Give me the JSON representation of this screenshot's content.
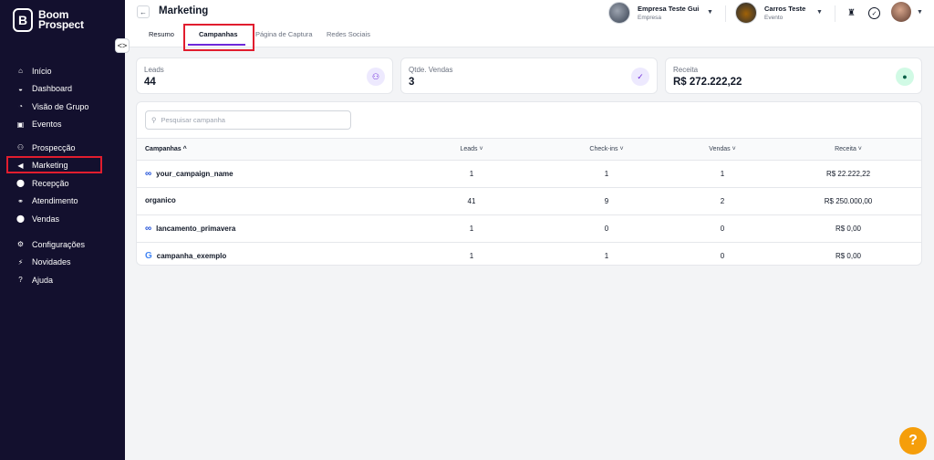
{
  "brand": {
    "line1": "Boom",
    "line2": "Prospect",
    "mark": "B"
  },
  "sidebar": {
    "groups": [
      [
        {
          "label": "Início",
          "icon": "home-icon",
          "glyph": "⌂"
        },
        {
          "label": "Dashboard",
          "icon": "dashboard-icon",
          "glyph": "◒"
        },
        {
          "label": "Visão de Grupo",
          "icon": "pie-chart-icon",
          "glyph": "◔"
        },
        {
          "label": "Eventos",
          "icon": "calendar-icon",
          "glyph": "▣"
        }
      ],
      [
        {
          "label": "Prospecção",
          "icon": "users-icon",
          "glyph": "⚇"
        },
        {
          "label": "Marketing",
          "icon": "megaphone-icon",
          "glyph": "◀",
          "active": true
        },
        {
          "label": "Recepção",
          "icon": "location-icon",
          "glyph": "⬤"
        },
        {
          "label": "Atendimento",
          "icon": "handshake-icon",
          "glyph": "⚭"
        },
        {
          "label": "Vendas",
          "icon": "money-icon",
          "glyph": "⬤"
        }
      ],
      [
        {
          "label": "Configurações",
          "icon": "gear-icon",
          "glyph": "⚙"
        },
        {
          "label": "Novidades",
          "icon": "bolt-icon",
          "glyph": "⚡"
        },
        {
          "label": "Ajuda",
          "icon": "question-icon",
          "glyph": "?"
        }
      ]
    ]
  },
  "header": {
    "title": "Marketing",
    "tabs": [
      "Resumo",
      "Campanhas",
      "Página de Captura",
      "Redes Sociais"
    ],
    "active_tab": 1,
    "account1": {
      "name": "Empresa Teste Gui",
      "sub": "Empresa"
    },
    "account2": {
      "name": "Carros Teste",
      "sub": "Evento"
    }
  },
  "stats": [
    {
      "label": "Leads",
      "value": "44",
      "icon": "users-icon",
      "glyph": "⚇",
      "bg": "#ede9fe",
      "fg": "#6d28d9"
    },
    {
      "label": "Qtde. Vendas",
      "value": "3",
      "icon": "check-circle-icon",
      "glyph": "✓",
      "bg": "#ede9fe",
      "fg": "#6d28d9"
    },
    {
      "label": "Receita",
      "value": "R$ 272.222,22",
      "icon": "user-icon",
      "glyph": "●",
      "bg": "#d1fae5",
      "fg": "#065f46"
    }
  ],
  "search": {
    "placeholder": "Pesquisar campanha"
  },
  "table": {
    "columns": [
      "Campanhas ^",
      "Leads ˅",
      "Check-ins ˅",
      "Vendas ˅",
      "Receita ˅"
    ],
    "rows": [
      {
        "name": "your_campaign_name",
        "source": "meta",
        "leads": "1",
        "checkins": "1",
        "vendas": "1",
        "receita": "R$ 22.222,22"
      },
      {
        "name": "organico",
        "source": "none",
        "leads": "41",
        "checkins": "9",
        "vendas": "2",
        "receita": "R$ 250.000,00"
      },
      {
        "name": "lancamento_primavera",
        "source": "meta",
        "leads": "1",
        "checkins": "0",
        "vendas": "0",
        "receita": "R$ 0,00"
      },
      {
        "name": "campanha_exemplo",
        "source": "google",
        "leads": "1",
        "checkins": "1",
        "vendas": "0",
        "receita": "R$ 0,00"
      }
    ]
  },
  "help": "?"
}
